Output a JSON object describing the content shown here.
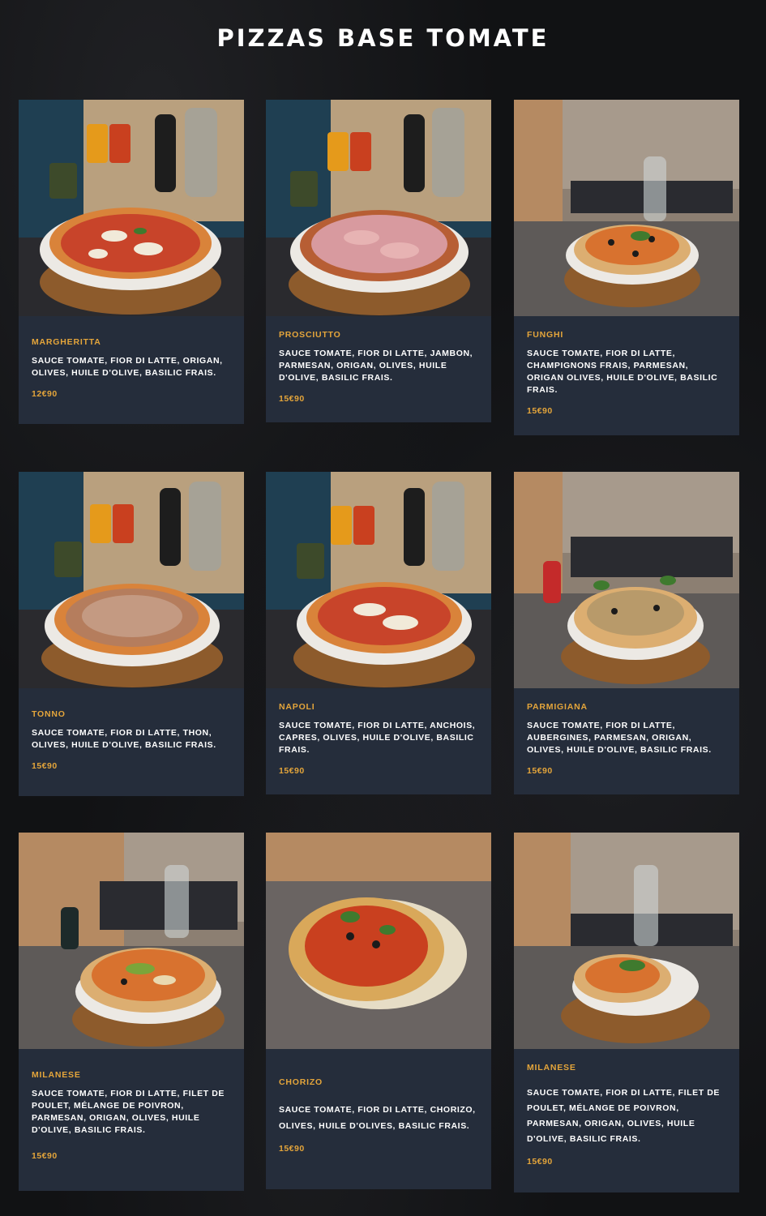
{
  "page": {
    "title": "PIZZAS BASE TOMATE"
  },
  "menu": [
    {
      "name": "MARGHERITTA",
      "desc": "SAUCE TOMATE, FIOR DI LATTE, ORIGAN, OLIVES, HUILE D'OLIVE, BASILIC FRAIS.",
      "price": "12€90"
    },
    {
      "name": "PROSCIUTTO",
      "desc": "SAUCE TOMATE, FIOR DI LATTE, JAMBON, PARMESAN, ORIGAN, OLIVES, HUILE D'OLIVE, BASILIC FRAIS.",
      "price": "15€90"
    },
    {
      "name": "FUNGHI",
      "desc": "SAUCE TOMATE, FIOR DI LATTE, CHAMPIGNONS FRAIS, PARMESAN, ORIGAN OLIVES, HUILE D'OLIVE, BASILIC FRAIS.",
      "price": "15€90"
    },
    {
      "name": "TONNO",
      "desc": "SAUCE TOMATE, FIOR DI LATTE, THON, OLIVES, HUILE D'OLIVE, BASILIC FRAIS.",
      "price": "15€90"
    },
    {
      "name": "NAPOLI",
      "desc": "SAUCE TOMATE, FIOR DI LATTE, ANCHOIS, CAPRES, OLIVES, HUILE D'OLIVE, BASILIC FRAIS.",
      "price": "15€90"
    },
    {
      "name": "PARMIGIANA",
      "desc": "SAUCE TOMATE, FIOR DI LATTE, AUBERGINES, PARMESAN, ORIGAN, OLIVES, HUILE D'OLIVE, BASILIC FRAIS.",
      "price": "15€90"
    },
    {
      "name": "MILANESE",
      "desc": "SAUCE TOMATE, FIOR DI LATTE, FILET DE POULET, MÉLANGE DE POIVRON, PARMESAN, ORIGAN, OLIVES, HUILE D'OLIVE, BASILIC FRAIS.",
      "price": "15€90"
    },
    {
      "name": "CHORIZO",
      "desc": "SAUCE TOMATE, FIOR DI LATTE, CHORIZO, OLIVES, HUILE D'OLIVES, BASILIC FRAIS.",
      "price": "15€90"
    },
    {
      "name": "MILANESE",
      "desc": "SAUCE TOMATE, FIOR DI LATTE, FILET DE POULET, MÉLANGE DE POIVRON, PARMESAN, ORIGAN, OLIVES, HUILE D'OLIVE, BASILIC FRAIS.",
      "price": "15€90"
    }
  ],
  "colors": {
    "card": "#252d3b",
    "accent": "#e4a53b",
    "background": "#111214"
  }
}
